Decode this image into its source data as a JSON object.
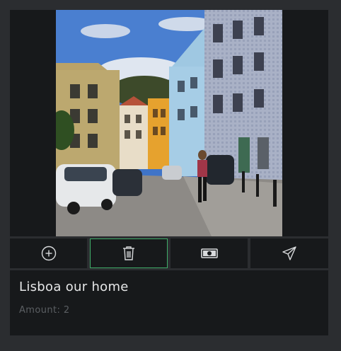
{
  "photo": {
    "icon": "street-photo"
  },
  "actions": [
    {
      "icon": "add-circle-icon",
      "selected": false
    },
    {
      "icon": "trash-icon",
      "selected": true
    },
    {
      "icon": "money-icon",
      "selected": false
    },
    {
      "icon": "send-icon",
      "selected": false
    }
  ],
  "info": {
    "title": "Lisboa our home",
    "amount_label": "Amount:",
    "amount_value": "2"
  },
  "colors": {
    "background": "#2b2d30",
    "panel": "#17191b",
    "accent": "#3fae69",
    "title_text": "#e6e7e8",
    "muted_text": "#5b5f63"
  }
}
